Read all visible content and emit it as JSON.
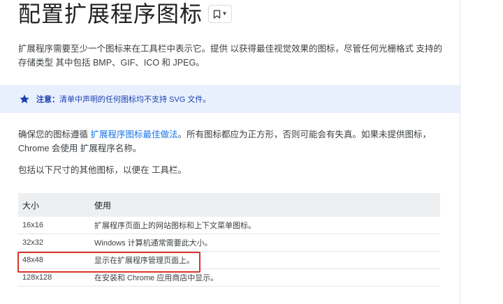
{
  "page": {
    "title": "配置扩展程序图标"
  },
  "intro": {
    "text": "扩展程序需要至少一个图标来在工具栏中表示它。提供 以获得最佳视觉效果的图标，尽管任何光栅格式 支持的存储类型 其中包括 BMP、GIF、ICO 和 JPEG。"
  },
  "note": {
    "label": "注意：",
    "text": "清单中声明的任何图标均不支持 SVG 文件。"
  },
  "guidelines": {
    "before": "确保您的图标遵循 ",
    "link": "扩展程序图标最佳做法",
    "after": "。所有图标都应为正方形，否则可能会有失真。如果未提供图标， Chrome 会使用 扩展程序名称。"
  },
  "toolbar_note": {
    "text": "包括以下尺寸的其他图标，以便在 工具栏。"
  },
  "table": {
    "headers": [
      "大小",
      "使用"
    ],
    "rows": [
      {
        "size": "16x16",
        "usage": "扩展程序页面上的网站图标和上下文菜单图标。"
      },
      {
        "size": "32x32",
        "usage": "Windows 计算机通常需要此大小。"
      },
      {
        "size": "48x48",
        "usage": "显示在扩展程序管理页面上。"
      },
      {
        "size": "128x128",
        "usage": "在安装和 Chrome 应用商店中显示。"
      }
    ]
  },
  "icons": {
    "bookmark": "bookmark-icon",
    "dropdown": "chevron-down-icon",
    "note": "star-icon"
  },
  "colors": {
    "note_background": "#e8f0fe",
    "note_text": "#1a3fae",
    "link": "#1a73e8",
    "highlight": "#d6362b",
    "table_header": "#eeeff1"
  }
}
